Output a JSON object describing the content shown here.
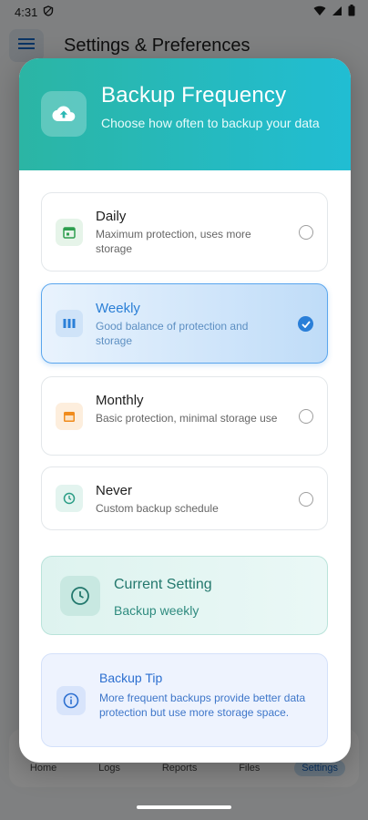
{
  "status_bar": {
    "time": "4:31"
  },
  "app_bar": {
    "title": "Settings & Preferences"
  },
  "bottom_nav": {
    "items": [
      {
        "label": "Home"
      },
      {
        "label": "Logs"
      },
      {
        "label": "Reports"
      },
      {
        "label": "Files"
      },
      {
        "label": "Settings",
        "active": true
      }
    ]
  },
  "dialog": {
    "header": {
      "title": "Backup Frequency",
      "subtitle": "Choose how often to backup your data",
      "icon": "cloud-upload-icon"
    },
    "options": [
      {
        "title": "Daily",
        "description": "Maximum protection, uses more storage",
        "icon": "calendar-day-icon",
        "selected": false
      },
      {
        "title": "Weekly",
        "description": "Good balance of protection and storage",
        "icon": "calendar-week-icon",
        "selected": true
      },
      {
        "title": "Monthly",
        "description": "Basic protection, minimal storage use",
        "icon": "calendar-month-icon",
        "selected": false
      },
      {
        "title": "Never",
        "description": "Custom backup schedule",
        "icon": "clock-icon",
        "selected": false
      }
    ],
    "current_setting": {
      "title": "Current Setting",
      "value": "Backup weekly"
    },
    "tip": {
      "title": "Backup Tip",
      "text": "More frequent backups provide better data protection but use more storage space."
    }
  },
  "colors": {
    "header_gradient_start": "#2bb5a4",
    "header_gradient_end": "#21bdd3",
    "selected_accent": "#2a7fd8",
    "current_setting_accent": "#23786d",
    "tip_accent": "#2c6fd0"
  }
}
